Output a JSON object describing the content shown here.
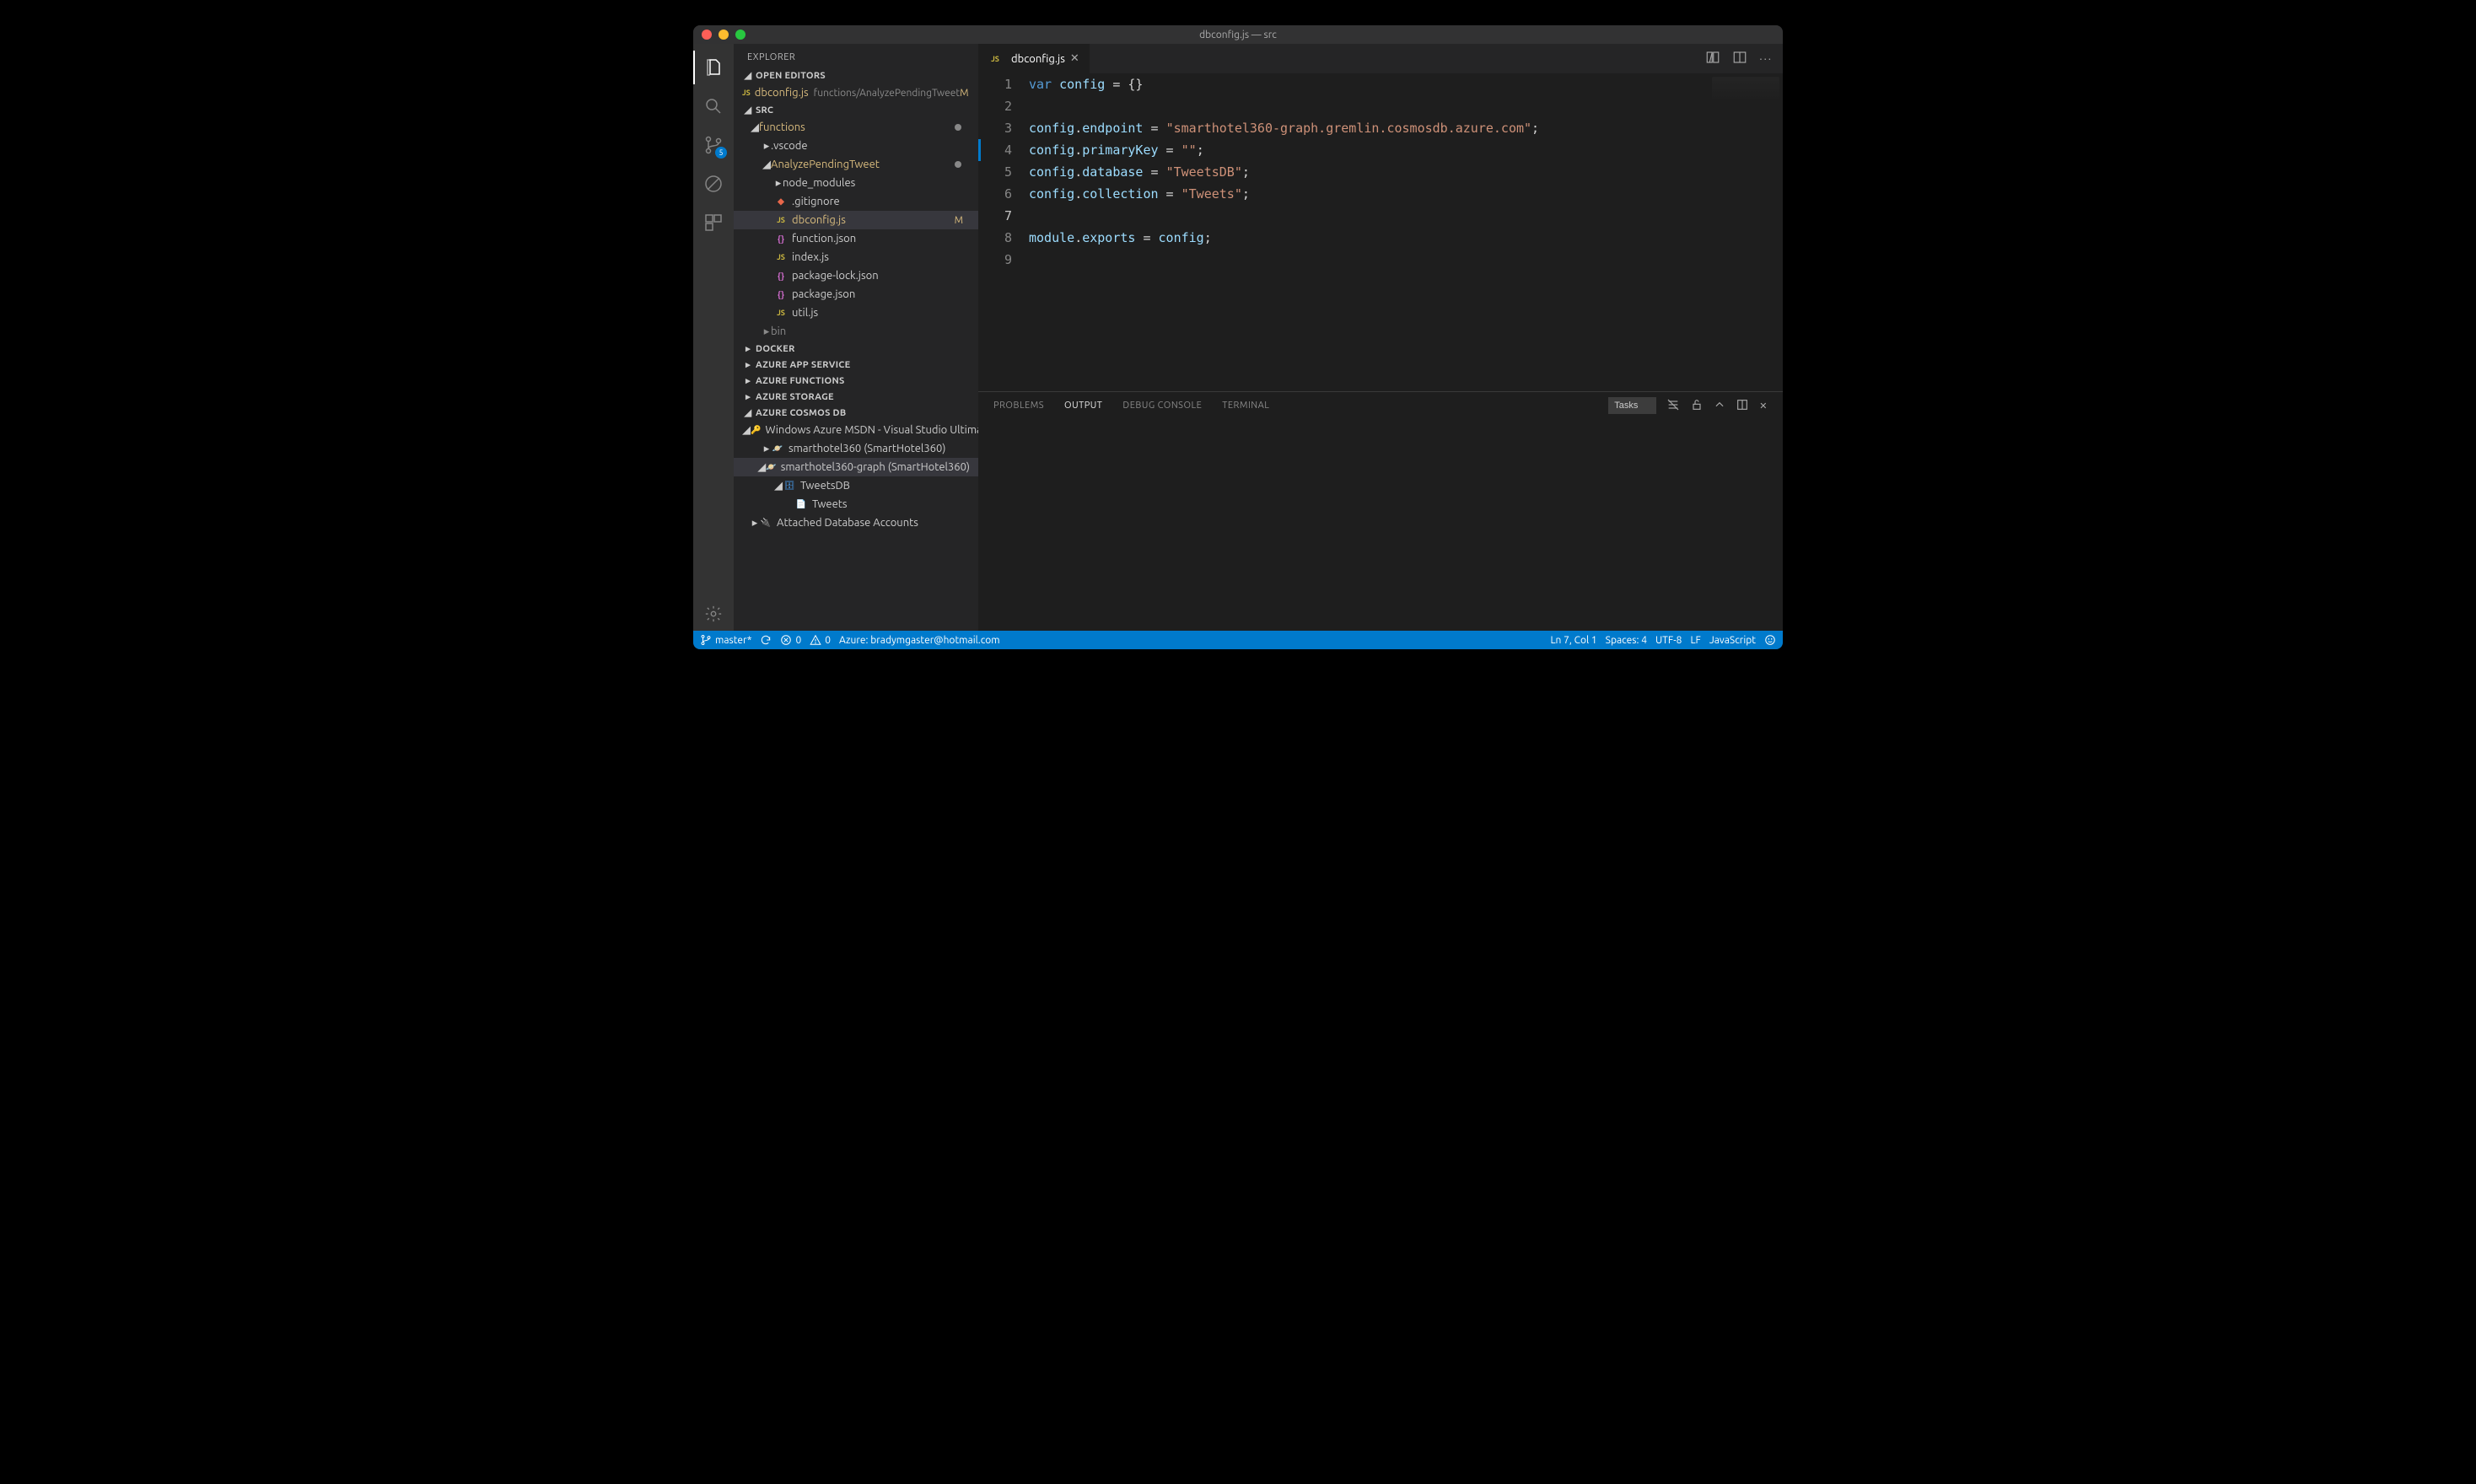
{
  "window": {
    "title": "dbconfig.js — src"
  },
  "activity": {
    "scm_badge": "5"
  },
  "sidebar": {
    "title": "EXPLORER",
    "open_editors_label": "OPEN EDITORS",
    "open_editors": [
      {
        "name": "dbconfig.js",
        "hint": "functions/AnalyzePendingTweet",
        "mod": "M",
        "icon": "JS"
      }
    ],
    "project": "SRC",
    "tree": {
      "functions": "functions",
      "vscode": ".vscode",
      "analyze": "AnalyzePendingTweet",
      "node_modules": "node_modules",
      "gitignore": ".gitignore",
      "dbconfig": "dbconfig.js",
      "dbconfig_mod": "M",
      "functionjson": "function.json",
      "indexjs": "index.js",
      "pkglock": "package-lock.json",
      "pkg": "package.json",
      "utiljs": "util.js",
      "bin": "bin"
    },
    "panels": {
      "docker": "DOCKER",
      "app_service": "AZURE APP SERVICE",
      "functions": "AZURE FUNCTIONS",
      "storage": "AZURE STORAGE",
      "cosmos": "AZURE COSMOS DB"
    },
    "cosmos": {
      "sub": "Windows Azure MSDN - Visual Studio Ultimate",
      "acct1": "smarthotel360 (SmartHotel360)",
      "acct2": "smarthotel360-graph (SmartHotel360)",
      "db": "TweetsDB",
      "coll": "Tweets",
      "attached": "Attached Database Accounts"
    }
  },
  "tabs": {
    "active": "dbconfig.js"
  },
  "editor": {
    "lines": [
      "1",
      "2",
      "3",
      "4",
      "5",
      "6",
      "7",
      "8",
      "9"
    ],
    "t": {
      "var": "var",
      "config": "config",
      "eq": " = ",
      "empty": "{}",
      "endpoint": "endpoint",
      "endpoint_val": "\"smarthotel360-graph.gremlin.cosmosdb.azure.com\"",
      "primaryKey": "primaryKey",
      "primaryKey_val": "\"\"",
      "database": "database",
      "database_val": "\"TweetsDB\"",
      "collection": "collection",
      "collection_val": "\"Tweets\"",
      "module": "module",
      "exports": "exports",
      "semi": ";",
      "dot": "."
    }
  },
  "panel": {
    "problems": "PROBLEMS",
    "output": "OUTPUT",
    "debug": "DEBUG CONSOLE",
    "terminal": "TERMINAL",
    "task_selected": "Tasks"
  },
  "status": {
    "branch": "master*",
    "errors": "0",
    "warnings": "0",
    "azure": "Azure: bradymgaster@hotmail.com",
    "position": "Ln 7, Col 1",
    "spaces": "Spaces: 4",
    "encoding": "UTF-8",
    "eol": "LF",
    "lang": "JavaScript"
  }
}
